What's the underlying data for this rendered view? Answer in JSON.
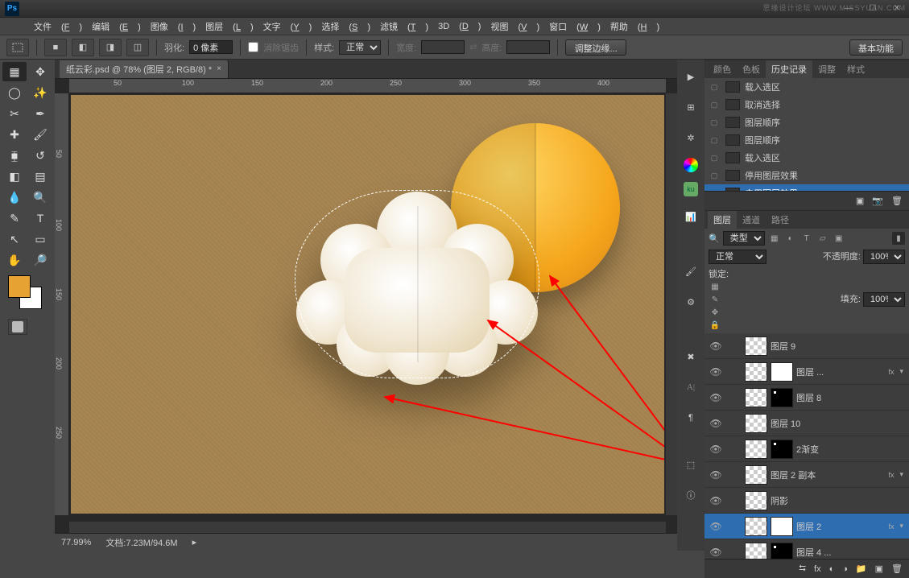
{
  "window": {
    "minimize": "—",
    "maximize": "☐",
    "close": "✕"
  },
  "menubar": [
    {
      "label": "文件",
      "key": "F"
    },
    {
      "label": "编辑",
      "key": "E"
    },
    {
      "label": "图像",
      "key": "I"
    },
    {
      "label": "图层",
      "key": "L"
    },
    {
      "label": "文字",
      "key": "Y"
    },
    {
      "label": "选择",
      "key": "S"
    },
    {
      "label": "滤镜",
      "key": "T"
    },
    {
      "label": "3D",
      "key": "D"
    },
    {
      "label": "视图",
      "key": "V"
    },
    {
      "label": "窗口",
      "key": "W"
    },
    {
      "label": "帮助",
      "key": "H"
    }
  ],
  "options": {
    "feather_label": "羽化:",
    "feather_value": "0 像素",
    "antialias": "消除锯齿",
    "style_label": "样式:",
    "style_value": "正常",
    "width_label": "宽度:",
    "height_label": "高度:",
    "refine": "调整边缘...",
    "workspace": "基本功能"
  },
  "doc": {
    "tab": "纸云彩.psd @ 78% (图层 2, RGB/8) *",
    "zoom": "77.99%",
    "docinfo": "文档:7.23M/94.6M"
  },
  "ruler_h": [
    "50",
    "100",
    "150",
    "200",
    "250",
    "300",
    "350",
    "400"
  ],
  "ruler_v": [
    "50",
    "100",
    "150",
    "200",
    "250"
  ],
  "panels": {
    "color_tab": "颜色",
    "swatches_tab": "色板",
    "history_tab": "历史记录",
    "adjust_tab": "调整",
    "styles_tab": "样式",
    "history": [
      {
        "label": "载入选区",
        "sel": false
      },
      {
        "label": "取消选择",
        "sel": false
      },
      {
        "label": "图层顺序",
        "sel": false
      },
      {
        "label": "图层顺序",
        "sel": false
      },
      {
        "label": "载入选区",
        "sel": false
      },
      {
        "label": "停用图层效果",
        "sel": false
      },
      {
        "label": "启用图层效果",
        "sel": true
      }
    ],
    "layers_tab": "图层",
    "channels_tab": "通道",
    "paths_tab": "路径",
    "layer_kind": "类型",
    "blend": "正常",
    "opacity_label": "不透明度:",
    "opacity": "100%",
    "lock_label": "锁定:",
    "fill_label": "填充:",
    "fill": "100%",
    "layers": [
      {
        "name": "图层 9",
        "thumbs": [
          "check"
        ],
        "sel": false
      },
      {
        "name": "图层 ...",
        "thumbs": [
          "check",
          "white"
        ],
        "fx": "fx",
        "sel": false
      },
      {
        "name": "图层 8",
        "thumbs": [
          "check",
          "blackdot"
        ],
        "sel": false
      },
      {
        "name": "图层 10",
        "thumbs": [
          "check"
        ],
        "sel": false
      },
      {
        "name": "2渐变",
        "thumbs": [
          "check",
          "black"
        ],
        "sel": false
      },
      {
        "name": "图层 2 副本",
        "thumbs": [
          "check"
        ],
        "fx": "fx",
        "sel": false
      },
      {
        "name": "阴影",
        "thumbs": [
          "check"
        ],
        "sel": false
      },
      {
        "name": "图层 2",
        "thumbs": [
          "check",
          "white"
        ],
        "fx": "fx",
        "sel": true
      },
      {
        "name": "图层 4 ...",
        "thumbs": [
          "check",
          "blackb"
        ],
        "sel": false
      }
    ]
  },
  "watermark": "思缘设计论坛 WWW.MISSYUAN.COM"
}
